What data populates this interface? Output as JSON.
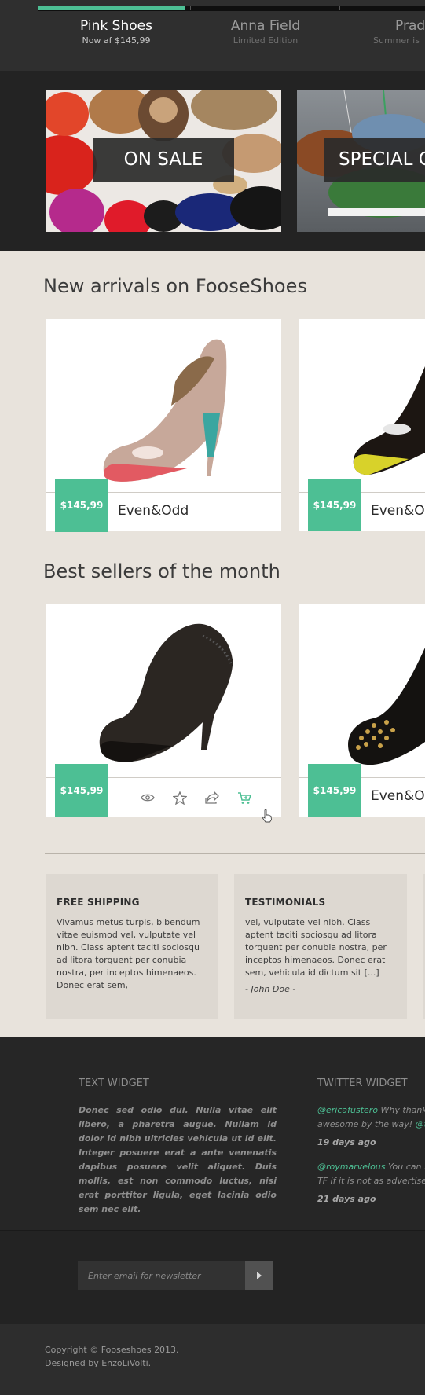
{
  "slider": {
    "progress": 0.38,
    "tabs": [
      {
        "title": "Pink Shoes",
        "subtitle": "Now af $145,99"
      },
      {
        "title": "Anna Field",
        "subtitle": "Limited Edition"
      },
      {
        "title": "Prad",
        "subtitle": "Summer is"
      }
    ]
  },
  "banners": [
    {
      "label": "ON SALE"
    },
    {
      "label": "SPECIAL C"
    }
  ],
  "sections": {
    "new_arrivals": {
      "title": "New arrivals on FooseShoes",
      "products": [
        {
          "price": "$145,99",
          "brand": "Even&Odd"
        },
        {
          "price": "$145,99",
          "brand": "Even&O"
        }
      ]
    },
    "best_sellers": {
      "title": "Best sellers of the month",
      "products": [
        {
          "price": "$145,99",
          "brand": ""
        },
        {
          "price": "$145,99",
          "brand": "Even&O"
        }
      ]
    }
  },
  "info_boxes": [
    {
      "title": "FREE SHIPPING",
      "text": "Vivamus metus turpis, bibendum vitae euismod vel, vulputate vel nibh. Class aptent taciti sociosqu ad litora torquent per conubia nostra, per inceptos himenaeos. Donec erat sem,",
      "sign": ""
    },
    {
      "title": "TESTIMONIALS",
      "text": "vel, vulputate vel nibh. Class aptent taciti sociosqu ad litora torquent per conubia nostra, per inceptos himenaeos. Donec erat sem, vehicula id dictum sit [...]",
      "sign": "- John Doe -"
    }
  ],
  "widgets": {
    "text_widget": {
      "title": "TEXT WIDGET",
      "body": "Donec sed odio dui. Nulla vitae elit libero, a pharetra augue. Nullam id dolor id nibh ultricies vehicula ut id elit. Integer posuere erat a ante venenatis dapibus posuere velit aliquet. Duis mollis, est non commodo luctus, nisi erat porttitor ligula, eget lacinia odio sem nec elit."
    },
    "twitter_widget": {
      "title": "TWITTER WIDGET",
      "tweets": [
        {
          "handle": "@ericafustero",
          "line1": " Why thank",
          "line2": "awesome by the way! ",
          "handle2": "@tr",
          "time": "19 days ago"
        },
        {
          "handle": "@roymarvelous",
          "line1": " You can s",
          "line2": "TF if it is not as advertised",
          "handle2": "",
          "time": "21 days ago"
        }
      ]
    }
  },
  "newsletter": {
    "placeholder": "Enter email for newsletter",
    "button_icon": "chevron-right-icon"
  },
  "copyright": {
    "line1": "Copyright © Fooseshoes 2013.",
    "line2": "Designed by EnzoLiVolti."
  },
  "colors": {
    "accent": "#4dbf94",
    "dark": "#232323",
    "beige": "#e8e3dc"
  }
}
